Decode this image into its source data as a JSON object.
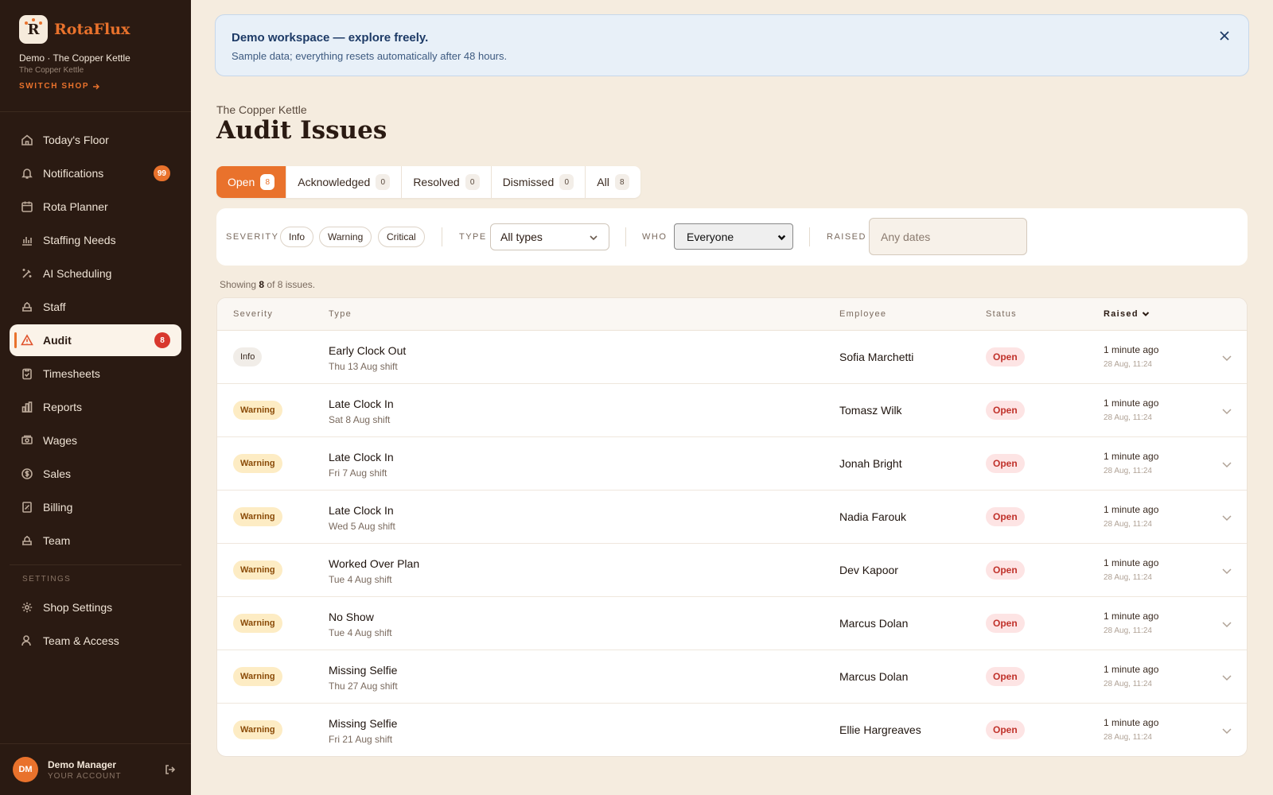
{
  "brand": {
    "initial": "R",
    "name": "RotaFlux"
  },
  "shop": {
    "line": "Demo · The Copper Kettle",
    "sub": "The Copper Kettle",
    "switch_label": "SWITCH SHOP"
  },
  "nav": [
    {
      "label": "Today's Floor",
      "icon": "home-icon"
    },
    {
      "label": "Notifications",
      "icon": "bell-icon",
      "badge": "99"
    },
    {
      "label": "Rota Planner",
      "icon": "calendar-icon"
    },
    {
      "label": "Staffing Needs",
      "icon": "bar-chart-icon"
    },
    {
      "label": "AI Scheduling",
      "icon": "wand-icon"
    },
    {
      "label": "Staff",
      "icon": "users-icon"
    },
    {
      "label": "Audit",
      "icon": "warning-triangle-icon",
      "badge": "8",
      "active": true
    },
    {
      "label": "Timesheets",
      "icon": "clipboard-icon"
    },
    {
      "label": "Reports",
      "icon": "reports-chart-icon"
    },
    {
      "label": "Wages",
      "icon": "banknote-icon"
    },
    {
      "label": "Sales",
      "icon": "dollar-circle-icon"
    },
    {
      "label": "Billing",
      "icon": "receipt-icon"
    },
    {
      "label": "Team",
      "icon": "team-icon"
    }
  ],
  "settings": {
    "label": "SETTINGS",
    "items": [
      {
        "label": "Shop Settings",
        "icon": "gear-icon"
      },
      {
        "label": "Team & Access",
        "icon": "user-key-icon"
      }
    ]
  },
  "user": {
    "initials": "DM",
    "name": "Demo Manager",
    "sub": "YOUR ACCOUNT"
  },
  "banner": {
    "title": "Demo workspace — explore freely.",
    "text": "Sample data; everything resets automatically after 48 hours."
  },
  "page": {
    "breadcrumb": "The Copper Kettle",
    "title": "Audit Issues"
  },
  "tabs": [
    {
      "label": "Open",
      "count": "8"
    },
    {
      "label": "Acknowledged",
      "count": "0"
    },
    {
      "label": "Resolved",
      "count": "0"
    },
    {
      "label": "Dismissed",
      "count": "0"
    },
    {
      "label": "All",
      "count": "8"
    }
  ],
  "filters": {
    "severity_label": "SEVERITY",
    "severity_chips": [
      "Info",
      "Warning",
      "Critical"
    ],
    "type_label": "TYPE",
    "type_value": "All types",
    "who_label": "WHO",
    "who_value": "Everyone",
    "raised_label": "RAISED",
    "raised_placeholder": "Any dates"
  },
  "showing": {
    "prefix": "Showing",
    "count": "8",
    "suffix": "of 8 issues."
  },
  "table": {
    "columns": [
      "Severity",
      "Type",
      "Employee",
      "Status",
      "Raised"
    ],
    "rows": [
      {
        "severity": "Info",
        "type": "Early Clock Out",
        "shift": "Thu 13 Aug shift",
        "employee": "Sofia Marchetti",
        "status": "Open",
        "raised": "1 minute ago",
        "raised_at": "28 Aug, 11:24"
      },
      {
        "severity": "Warning",
        "type": "Late Clock In",
        "shift": "Sat 8 Aug shift",
        "employee": "Tomasz Wilk",
        "status": "Open",
        "raised": "1 minute ago",
        "raised_at": "28 Aug, 11:24"
      },
      {
        "severity": "Warning",
        "type": "Late Clock In",
        "shift": "Fri 7 Aug shift",
        "employee": "Jonah Bright",
        "status": "Open",
        "raised": "1 minute ago",
        "raised_at": "28 Aug, 11:24"
      },
      {
        "severity": "Warning",
        "type": "Late Clock In",
        "shift": "Wed 5 Aug shift",
        "employee": "Nadia Farouk",
        "status": "Open",
        "raised": "1 minute ago",
        "raised_at": "28 Aug, 11:24"
      },
      {
        "severity": "Warning",
        "type": "Worked Over Plan",
        "shift": "Tue 4 Aug shift",
        "employee": "Dev Kapoor",
        "status": "Open",
        "raised": "1 minute ago",
        "raised_at": "28 Aug, 11:24"
      },
      {
        "severity": "Warning",
        "type": "No Show",
        "shift": "Tue 4 Aug shift",
        "employee": "Marcus Dolan",
        "status": "Open",
        "raised": "1 minute ago",
        "raised_at": "28 Aug, 11:24"
      },
      {
        "severity": "Warning",
        "type": "Missing Selfie",
        "shift": "Thu 27 Aug shift",
        "employee": "Marcus Dolan",
        "status": "Open",
        "raised": "1 minute ago",
        "raised_at": "28 Aug, 11:24"
      },
      {
        "severity": "Warning",
        "type": "Missing Selfie",
        "shift": "Fri 21 Aug shift",
        "employee": "Ellie Hargreaves",
        "status": "Open",
        "raised": "1 minute ago",
        "raised_at": "28 Aug, 11:24"
      }
    ]
  }
}
